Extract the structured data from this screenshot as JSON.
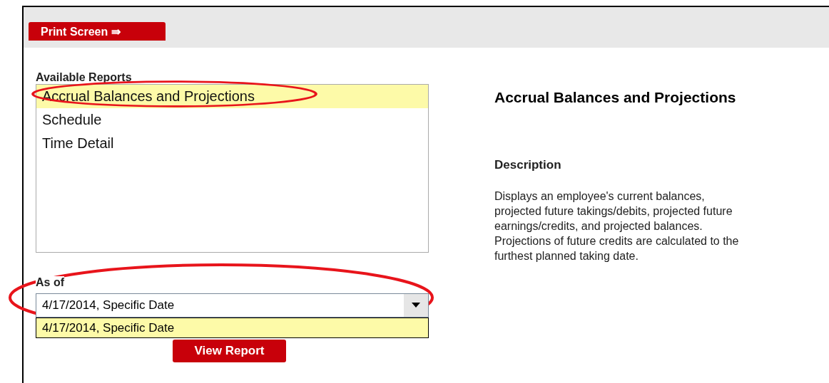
{
  "toolbar": {
    "print_button": "Print Screen ⇛"
  },
  "reports": {
    "label": "Available Reports",
    "items": [
      {
        "label": "Accrual Balances and Projections",
        "selected": true,
        "circled": true
      },
      {
        "label": "Schedule",
        "selected": false,
        "circled": false
      },
      {
        "label": "Time Detail",
        "selected": false,
        "circled": false
      }
    ]
  },
  "as_of": {
    "label": "As of",
    "value": "4/17/2014, Specific Date",
    "circled": true,
    "options": [
      {
        "label": "4/17/2014, Specific Date",
        "selected": true
      }
    ]
  },
  "view_button": "View Report",
  "details": {
    "title": "Accrual Balances and Projections",
    "heading": "Description",
    "text": "Displays an employee's current balances, projected future takings/debits, projected future earnings/credits, and projected balances. Projections of future credits are calculated to the furthest planned taking date."
  }
}
